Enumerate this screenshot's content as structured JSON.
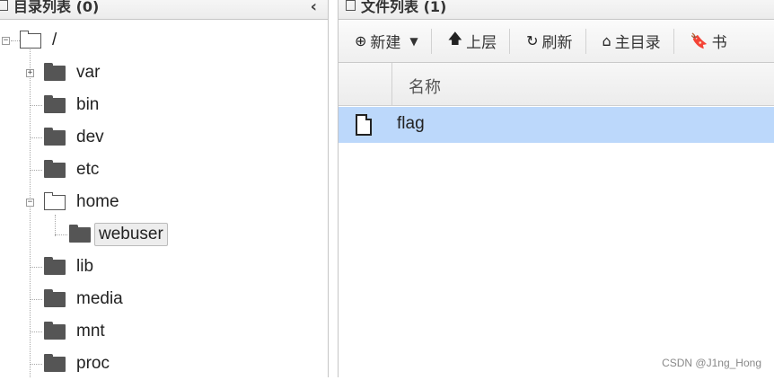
{
  "left_panel": {
    "title": "目录列表 (0)",
    "collapse_glyph": "‹"
  },
  "tree": {
    "root": {
      "label": "/",
      "expander": "−"
    },
    "var": {
      "label": "var",
      "expander": "+"
    },
    "bin": {
      "label": "bin"
    },
    "dev": {
      "label": "dev"
    },
    "etc": {
      "label": "etc"
    },
    "home": {
      "label": "home",
      "expander": "−"
    },
    "webuser": {
      "label": "webuser"
    },
    "lib": {
      "label": "lib"
    },
    "media": {
      "label": "media"
    },
    "mnt": {
      "label": "mnt"
    },
    "proc": {
      "label": "proc"
    }
  },
  "right_panel": {
    "title": "文件列表 (1)"
  },
  "toolbar": {
    "new_label": "新建",
    "new_icon": "plus-circle-icon",
    "up_label": "上层",
    "up_icon": "arrow-up-icon",
    "refresh_label": "刷新",
    "refresh_icon": "refresh-icon",
    "home_label": "主目录",
    "home_icon": "home-icon",
    "bookmark_label": "书",
    "bookmark_icon": "bookmark-icon"
  },
  "file_table": {
    "column_name": "名称",
    "rows": [
      {
        "name": "flag",
        "icon": "file-icon",
        "selected": true
      }
    ]
  },
  "colors": {
    "selected_row": "#bcd8fb",
    "folder": "#555555"
  },
  "watermark": "CSDN @J1ng_Hong"
}
